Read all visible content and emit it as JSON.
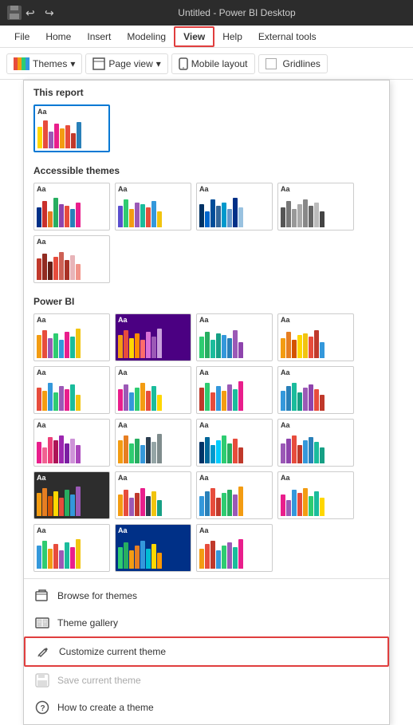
{
  "titleBar": {
    "title": "Untitled - Power BI Desktop"
  },
  "menuBar": {
    "items": [
      {
        "label": "File",
        "active": false
      },
      {
        "label": "Home",
        "active": false
      },
      {
        "label": "Insert",
        "active": false
      },
      {
        "label": "Modeling",
        "active": false
      },
      {
        "label": "View",
        "active": true,
        "highlighted": true
      },
      {
        "label": "Help",
        "active": false
      },
      {
        "label": "External tools",
        "active": false
      }
    ]
  },
  "ribbon": {
    "themes_label": "Themes",
    "pageview_label": "Page view",
    "mobilelayout_label": "Mobile layout",
    "gridlines_label": "Gridlines"
  },
  "sections": {
    "thisReport": {
      "header": "This report"
    },
    "accessibleThemes": {
      "header": "Accessible themes"
    },
    "powerBI": {
      "header": "Power BI"
    }
  },
  "menuOptions": [
    {
      "id": "browse",
      "label": "Browse for themes",
      "icon": "📁",
      "disabled": false
    },
    {
      "id": "gallery",
      "label": "Theme gallery",
      "icon": "🖼",
      "disabled": false
    },
    {
      "id": "customize",
      "label": "Customize current theme",
      "icon": "✏",
      "disabled": false,
      "highlighted": true
    },
    {
      "id": "save",
      "label": "Save current theme",
      "icon": "💾",
      "disabled": true
    },
    {
      "id": "howto",
      "label": "How to create a theme",
      "icon": "❓",
      "disabled": false
    }
  ]
}
